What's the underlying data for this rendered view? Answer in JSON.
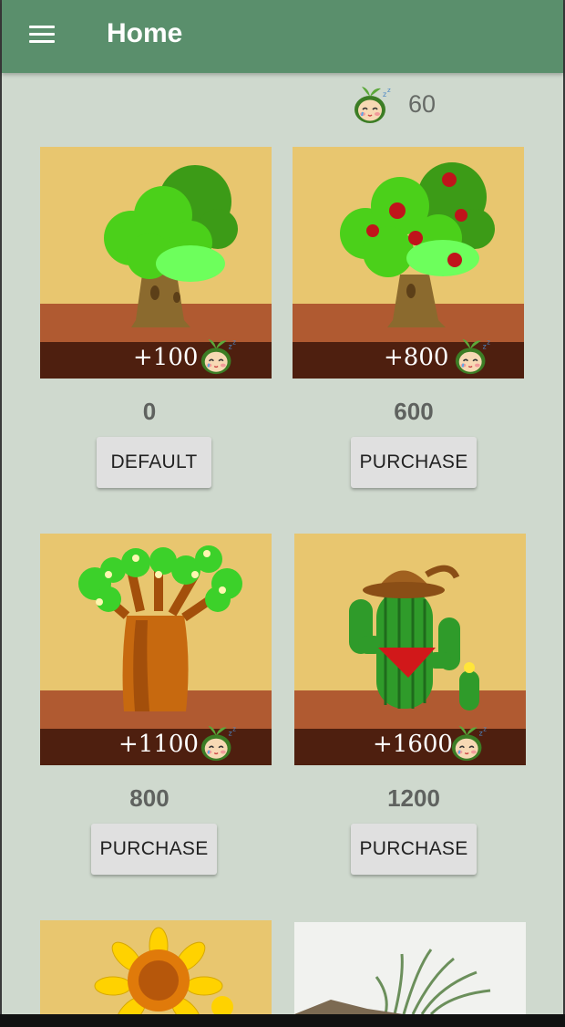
{
  "appbar": {
    "title": "Home",
    "menu_icon": "hamburger-menu-icon"
  },
  "balance": {
    "icon": "sprout-seed-icon",
    "value": "60"
  },
  "shop_items": [
    {
      "name": "Oak Tree",
      "reward": "+100",
      "price": "0",
      "button": "DEFAULT"
    },
    {
      "name": "Apple Tree",
      "reward": "+800",
      "price": "600",
      "button": "PURCHASE"
    },
    {
      "name": "Baobab Tree",
      "reward": "+1100",
      "price": "800",
      "button": "PURCHASE"
    },
    {
      "name": "Cactus",
      "reward": "+1600",
      "price": "1200",
      "button": "PURCHASE"
    }
  ],
  "colors": {
    "appbar": "#5a8f6c",
    "background": "#cfd9ce",
    "card_sky": "#e8c66f",
    "soil": "#b05a31",
    "dark_soil": "#4e1f0f",
    "button": "#e0e0e0"
  }
}
